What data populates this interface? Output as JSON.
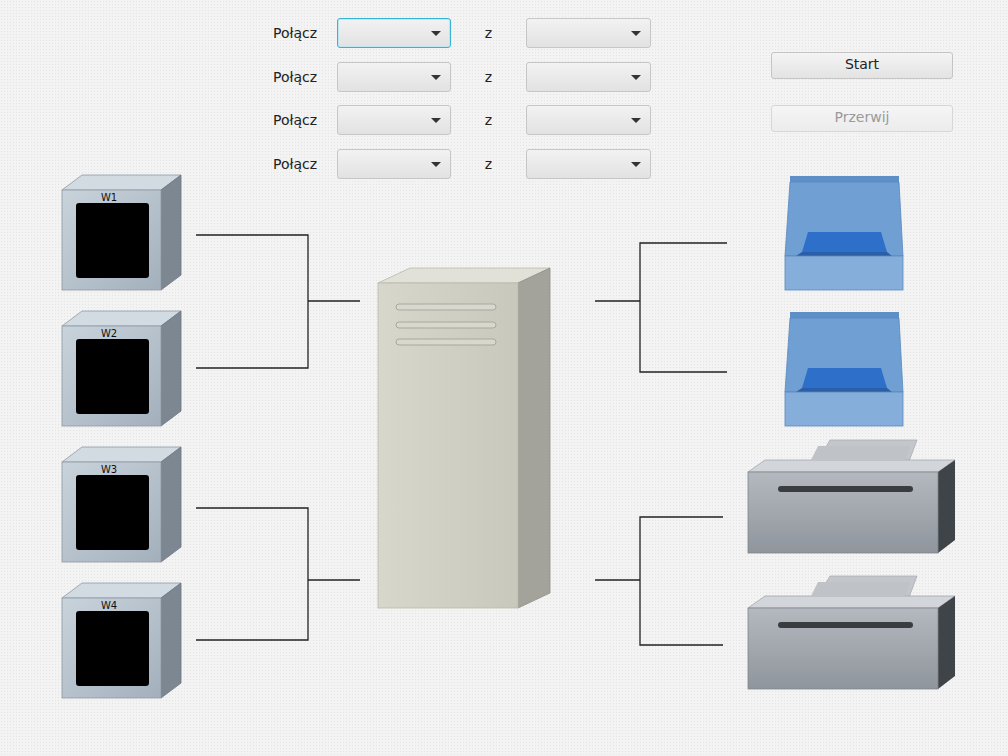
{
  "connections": [
    {
      "label": "Połącz",
      "connector": "z",
      "focused": true
    },
    {
      "label": "Połącz",
      "connector": "z",
      "focused": false
    },
    {
      "label": "Połącz",
      "connector": "z",
      "focused": false
    },
    {
      "label": "Połącz",
      "connector": "z",
      "focused": false
    }
  ],
  "buttons": [
    {
      "label": "Start",
      "disabled": false
    },
    {
      "label": "Przerwij",
      "disabled": true
    }
  ],
  "terminals": [
    {
      "label": "W1"
    },
    {
      "label": "W2"
    },
    {
      "label": "W3"
    },
    {
      "label": "W4"
    }
  ],
  "devices": [
    {
      "kind": "scanner"
    },
    {
      "kind": "scanner"
    },
    {
      "kind": "printer"
    },
    {
      "kind": "printer"
    }
  ]
}
